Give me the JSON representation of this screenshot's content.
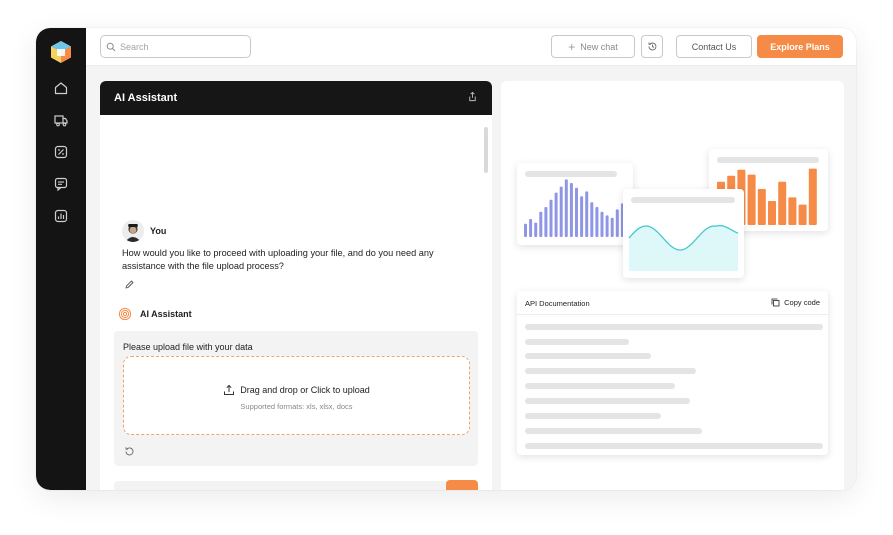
{
  "search": {
    "placeholder": "Search"
  },
  "topbar": {
    "new_chat_label": "New chat",
    "contact_label": "Contact Us",
    "explore_label": "Explore Plans"
  },
  "sidebar": {
    "items": [
      {
        "icon": "home-icon"
      },
      {
        "icon": "truck-icon"
      },
      {
        "icon": "percent-icon"
      },
      {
        "icon": "chat-icon"
      },
      {
        "icon": "chart-icon"
      }
    ]
  },
  "chat": {
    "title": "AI Assistant",
    "user_name": "You",
    "user_message": "How would you like to proceed with uploading your file, and do you need any assistance with the file upload process?",
    "assistant_name": "AI Assistant",
    "upload_prompt": "Please upload file with your data",
    "drop_text": "Drag and drop or Click to upload",
    "supported_formats": "Supported formats: xls, xlsx, docs"
  },
  "preview": {
    "api_title": "API Documentation",
    "copy_label": "Copy code",
    "bar_chart_values": [
      0.22,
      0.3,
      0.24,
      0.42,
      0.5,
      0.62,
      0.74,
      0.84,
      0.96,
      0.9,
      0.82,
      0.68,
      0.76,
      0.58,
      0.5,
      0.42,
      0.36,
      0.32,
      0.46,
      0.56
    ],
    "orange_bar_values": [
      0.72,
      0.82,
      0.92,
      0.84,
      0.6,
      0.4,
      0.72,
      0.46,
      0.34,
      0.94
    ],
    "colors": {
      "accent": "#f58b46",
      "bars": "#8f96e6",
      "wave": "#46c8cf"
    }
  }
}
